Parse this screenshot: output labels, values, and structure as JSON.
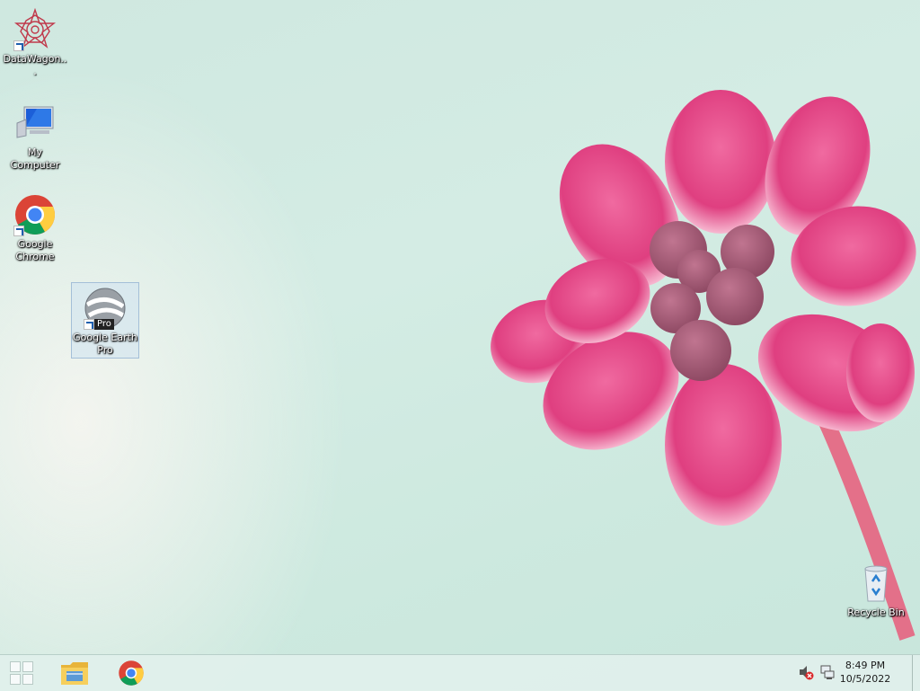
{
  "desktop": {
    "icons": [
      {
        "label": "DataWagon...",
        "icon": "datawagon-star-icon"
      },
      {
        "label": "My Computer",
        "icon": "computer-monitor-icon"
      },
      {
        "label": "Google Chrome",
        "icon": "chrome-icon"
      },
      {
        "label": "Google Earth Pro",
        "icon": "google-earth-pro-icon",
        "badge": "Pro",
        "selected": true
      },
      {
        "label": "Recycle Bin",
        "icon": "recycle-bin-icon"
      }
    ]
  },
  "taskbar": {
    "start": "windows-start-icon",
    "pinned": [
      "file-explorer-icon",
      "chrome-icon"
    ],
    "tray": [
      "volume-muted-icon",
      "network-icon"
    ],
    "time": "8:49 PM",
    "date": "10/5/2022"
  },
  "colors": {
    "flower": "#e0407f",
    "taskbar": "#e1f0ec"
  }
}
